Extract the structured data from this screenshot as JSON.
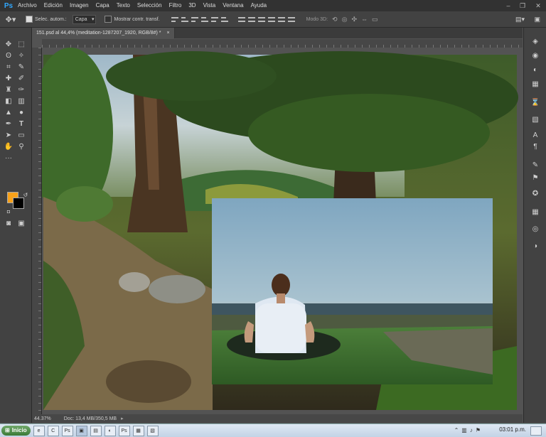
{
  "app": {
    "logo": "Ps"
  },
  "menu": [
    "Archivo",
    "Edición",
    "Imagen",
    "Capa",
    "Texto",
    "Selección",
    "Filtro",
    "3D",
    "Vista",
    "Ventana",
    "Ayuda"
  ],
  "options": {
    "auto_select_label": "Selec. autom.:",
    "auto_select_value": "Capa",
    "transform_label": "Mostrar contr. transf.",
    "mode3d_label": "Modo 3D:"
  },
  "document": {
    "tab_title": "151.psd al 44,4% (meditation-1287207_1920, RGB/8#) *",
    "tab_close": "×"
  },
  "status": {
    "zoom": "44.37%",
    "doc": "Doc: 13,4 MB/350,5 MB"
  },
  "taskbar": {
    "start_label": "Inicio",
    "apps": [
      "e",
      "C",
      "Ps",
      "▣",
      "▤",
      "◐",
      "Ps",
      "▦",
      "▧"
    ],
    "clock": "03:01 p.m."
  },
  "icons": {
    "move": "move-icon",
    "marquee": "marquee-icon",
    "lasso": "lasso-icon",
    "magic": "magic-wand-icon",
    "crop": "crop-icon",
    "eyedropper": "eyedropper-icon",
    "heal": "healing-brush-icon",
    "brush": "brush-icon",
    "stamp": "clone-stamp-icon",
    "history": "history-brush-icon",
    "eraser": "eraser-icon",
    "gradient": "gradient-icon",
    "blur": "blur-icon",
    "dodge": "dodge-icon",
    "pen": "pen-icon",
    "type": "type-icon",
    "path": "path-selection-icon",
    "shape": "shape-icon",
    "hand": "hand-icon",
    "zoom": "zoom-icon"
  },
  "colors": {
    "foreground": "#f7a11a",
    "background": "#000000",
    "accent": "#31a8ff"
  }
}
